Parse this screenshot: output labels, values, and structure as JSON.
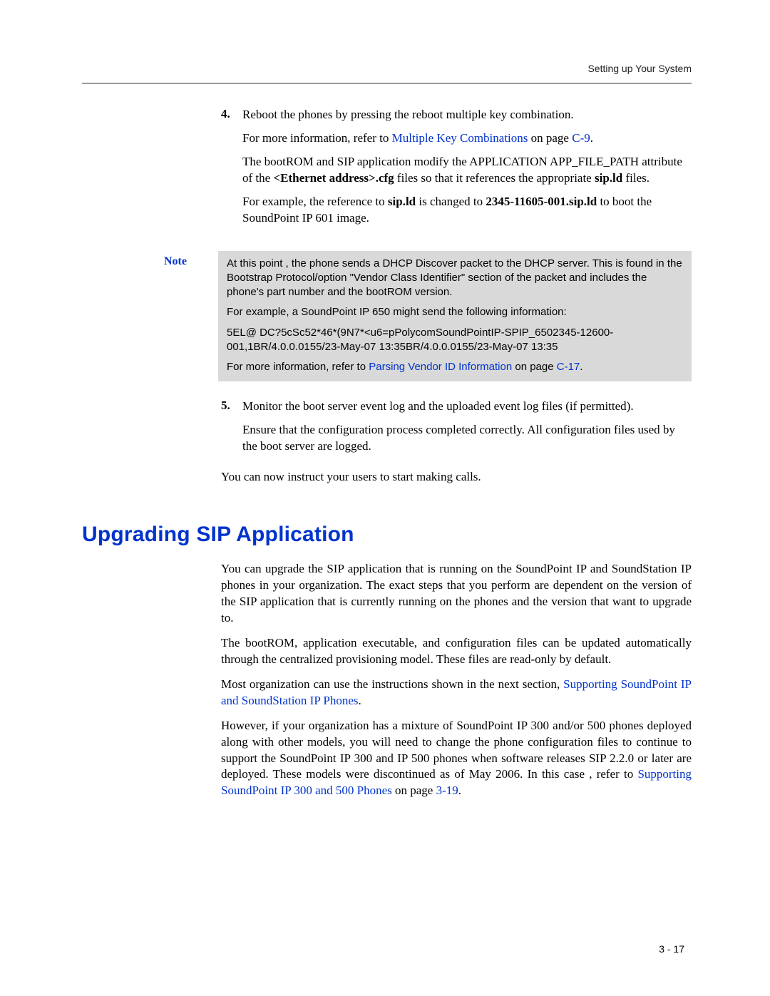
{
  "running_head": "Setting up Your System",
  "step4": {
    "num": "4.",
    "text": "Reboot the phones by pressing the reboot multiple key combination.",
    "more_info_pre": "For more information, refer to ",
    "more_info_link": "Multiple Key Combinations",
    "more_info_mid": " on page ",
    "more_info_page": "C-9",
    "more_info_post": ".",
    "bootrom_p1a": "The bootROM and SIP application modify the APPLICATION APP_FILE_PATH attribute of the ",
    "bootrom_p1b": "<Ethernet address>.cfg",
    "bootrom_p1c": " files so that it references the appropriate ",
    "bootrom_p1d": "sip.ld",
    "bootrom_p1e": " files.",
    "example_a": "For example, the reference to ",
    "example_b": "sip.ld",
    "example_c": " is changed to ",
    "example_d": "2345-11605-001.sip.ld",
    "example_e": " to boot the SoundPoint IP 601 image."
  },
  "note": {
    "label": "Note",
    "p1": "At this point , the phone sends a DHCP Discover packet to the DHCP server. This is found in the Bootstrap Protocol/option \"Vendor Class Identifier\" section of the packet and includes the phone's part number and the bootROM version.",
    "p2": "For example, a SoundPoint IP 650 might send the following information:",
    "p3": "5EL@ DC?5cSc52*46*(9N7*<u6=pPolycomSoundPointIP-SPIP_6502345-12600-001,1BR/4.0.0.0155/23-May-07 13:35BR/4.0.0.0155/23-May-07 13:35",
    "p4a": "For more information, refer to ",
    "p4link": "Parsing Vendor ID Information",
    "p4b": " on page ",
    "p4page": "C-17",
    "p4c": "."
  },
  "step5": {
    "num": "5.",
    "text": "Monitor the boot server event log and the uploaded event log files (if permitted).",
    "p2": "Ensure that the configuration process completed correctly. All configuration files used by the boot server are logged."
  },
  "closing": "You can now instruct your users to start making calls.",
  "heading": "Upgrading SIP Application",
  "u_p1": "You can upgrade the SIP application that is running on the SoundPoint IP and SoundStation IP phones in your organization. The exact steps that you perform are dependent on the version of the SIP application that is currently running on the phones and the version that want to upgrade to.",
  "u_p2": "The bootROM, application executable, and configuration files can be updated automatically through the centralized provisioning model. These files are read-only by default.",
  "u_p3a": "Most organization can use the instructions shown in the next section, ",
  "u_p3link": "Supporting SoundPoint IP and SoundStation IP Phones",
  "u_p3b": ".",
  "u_p4a": "However, if your organization has a mixture of SoundPoint IP 300 and/or 500 phones deployed along with other models, you will need to change the phone configuration files to continue to support the SoundPoint IP 300 and IP 500 phones when software releases SIP 2.2.0 or later are deployed. These models were discontinued as of May 2006. In this case , refer to ",
  "u_p4link": "Supporting SoundPoint IP 300 and 500 Phones",
  "u_p4b": " on page ",
  "u_p4page": "3-19",
  "u_p4c": ".",
  "page_num": "3 - 17"
}
